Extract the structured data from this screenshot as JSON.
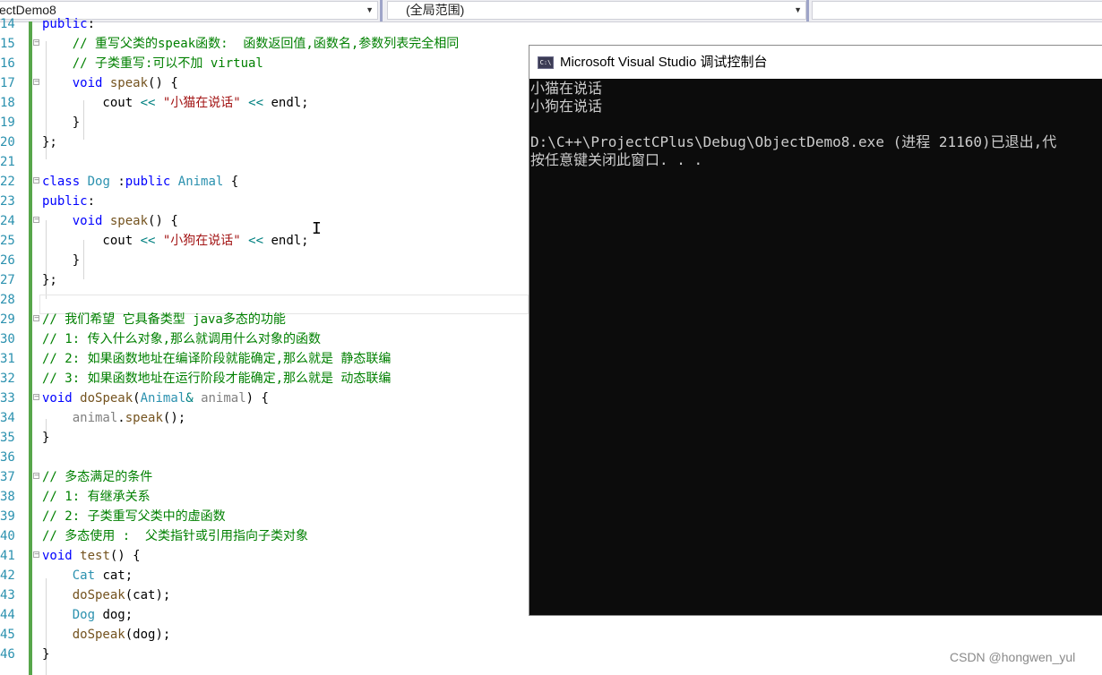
{
  "toolbar": {
    "project_dropdown": "ectDemo8",
    "scope_dropdown": "(全局范围)",
    "member_dropdown": ""
  },
  "editor": {
    "lines": [
      {
        "n": "14",
        "tokens": [
          [
            "kw",
            "public"
          ],
          [
            "",
            "​:"
          ]
        ]
      },
      {
        "n": "15",
        "tokens": [
          [
            "",
            "    "
          ],
          [
            "cm",
            "// 重写父类的speak函数:  函数返回值,函数名,参数列表完全相同"
          ]
        ]
      },
      {
        "n": "16",
        "tokens": [
          [
            "",
            "    "
          ],
          [
            "cm",
            "// 子类重写:可以不加 virtual"
          ]
        ]
      },
      {
        "n": "17",
        "tokens": [
          [
            "",
            "    "
          ],
          [
            "kw",
            "void"
          ],
          [
            "",
            " "
          ],
          [
            "fn",
            "speak"
          ],
          [
            "",
            "() {"
          ]
        ]
      },
      {
        "n": "18",
        "tokens": [
          [
            "",
            "        cout "
          ],
          [
            "op",
            "<<"
          ],
          [
            "",
            " "
          ],
          [
            "str",
            "\"小猫在说话\""
          ],
          [
            "",
            " "
          ],
          [
            "op",
            "<<"
          ],
          [
            "",
            " endl;"
          ]
        ]
      },
      {
        "n": "19",
        "tokens": [
          [
            "",
            "    }"
          ]
        ]
      },
      {
        "n": "20",
        "tokens": [
          [
            "",
            "};"
          ]
        ]
      },
      {
        "n": "21",
        "tokens": []
      },
      {
        "n": "22",
        "tokens": [
          [
            "kw",
            "class"
          ],
          [
            "",
            " "
          ],
          [
            "ty",
            "Dog"
          ],
          [
            "",
            " :"
          ],
          [
            "kw",
            "public"
          ],
          [
            "",
            " "
          ],
          [
            "ty",
            "Animal"
          ],
          [
            "",
            " {"
          ]
        ]
      },
      {
        "n": "23",
        "tokens": [
          [
            "kw",
            "public"
          ],
          [
            "",
            ":"
          ]
        ]
      },
      {
        "n": "24",
        "tokens": [
          [
            "",
            "    "
          ],
          [
            "kw",
            "void"
          ],
          [
            "",
            " "
          ],
          [
            "fn",
            "speak"
          ],
          [
            "",
            "() {"
          ]
        ]
      },
      {
        "n": "25",
        "tokens": [
          [
            "",
            "        cout "
          ],
          [
            "op",
            "<<"
          ],
          [
            "",
            " "
          ],
          [
            "str",
            "\"小狗在说话\""
          ],
          [
            "",
            " "
          ],
          [
            "op",
            "<<"
          ],
          [
            "",
            " endl;"
          ]
        ]
      },
      {
        "n": "26",
        "tokens": [
          [
            "",
            "    }"
          ]
        ]
      },
      {
        "n": "27",
        "tokens": [
          [
            "",
            "};"
          ]
        ]
      },
      {
        "n": "28",
        "tokens": []
      },
      {
        "n": "29",
        "tokens": [
          [
            "cm",
            "// 我们希望 它具备类型 java多态的功能"
          ]
        ]
      },
      {
        "n": "30",
        "tokens": [
          [
            "cm",
            "// 1: 传入什么对象,那么就调用什么对象的函数"
          ]
        ]
      },
      {
        "n": "31",
        "tokens": [
          [
            "cm",
            "// 2: 如果函数地址在编译阶段就能确定,那么就是 静态联编"
          ]
        ]
      },
      {
        "n": "32",
        "tokens": [
          [
            "cm",
            "// 3: 如果函数地址在运行阶段才能确定,那么就是 动态联编"
          ]
        ]
      },
      {
        "n": "33",
        "tokens": [
          [
            "kw",
            "void"
          ],
          [
            "",
            " "
          ],
          [
            "fn",
            "doSpeak"
          ],
          [
            "",
            "("
          ],
          [
            "ty",
            "Animal"
          ],
          [
            "op",
            "&"
          ],
          [
            "",
            " "
          ],
          [
            "pm",
            "animal"
          ],
          [
            "",
            ") {"
          ]
        ]
      },
      {
        "n": "34",
        "tokens": [
          [
            "",
            "    "
          ],
          [
            "pm",
            "animal"
          ],
          [
            "",
            "."
          ],
          [
            "fn",
            "speak"
          ],
          [
            "",
            "();"
          ]
        ]
      },
      {
        "n": "35",
        "tokens": [
          [
            "",
            "}"
          ]
        ]
      },
      {
        "n": "36",
        "tokens": []
      },
      {
        "n": "37",
        "tokens": [
          [
            "cm",
            "// 多态满足的条件"
          ]
        ]
      },
      {
        "n": "38",
        "tokens": [
          [
            "cm",
            "// 1: 有继承关系"
          ]
        ]
      },
      {
        "n": "39",
        "tokens": [
          [
            "cm",
            "// 2: 子类重写父类中的虚函数"
          ]
        ]
      },
      {
        "n": "40",
        "tokens": [
          [
            "cm",
            "// 多态使用 :  父类指针或引用指向子类对象"
          ]
        ]
      },
      {
        "n": "41",
        "tokens": [
          [
            "kw",
            "void"
          ],
          [
            "",
            " "
          ],
          [
            "fn",
            "test"
          ],
          [
            "",
            "() {"
          ]
        ]
      },
      {
        "n": "42",
        "tokens": [
          [
            "",
            "    "
          ],
          [
            "ty",
            "Cat"
          ],
          [
            "",
            " cat;"
          ]
        ]
      },
      {
        "n": "43",
        "tokens": [
          [
            "",
            "    "
          ],
          [
            "fn",
            "doSpeak"
          ],
          [
            "",
            "(cat);"
          ]
        ]
      },
      {
        "n": "44",
        "tokens": [
          [
            "",
            "    "
          ],
          [
            "ty",
            "Dog"
          ],
          [
            "",
            " dog;"
          ]
        ]
      },
      {
        "n": "45",
        "tokens": [
          [
            "",
            "    "
          ],
          [
            "fn",
            "doSpeak"
          ],
          [
            "",
            "(dog);"
          ]
        ]
      },
      {
        "n": "46",
        "tokens": [
          [
            "",
            "}"
          ]
        ]
      }
    ]
  },
  "console": {
    "icon_label": "C:\\",
    "title": "Microsoft Visual Studio 调试控制台",
    "output": [
      "小猫在说话",
      "小狗在说话",
      "",
      "D:\\C++\\ProjectCPlus\\Debug\\ObjectDemo8.exe (进程 21160)已退出,代",
      "按任意键关闭此窗口. . ."
    ]
  },
  "watermark": "CSDN @hongwen_yul"
}
